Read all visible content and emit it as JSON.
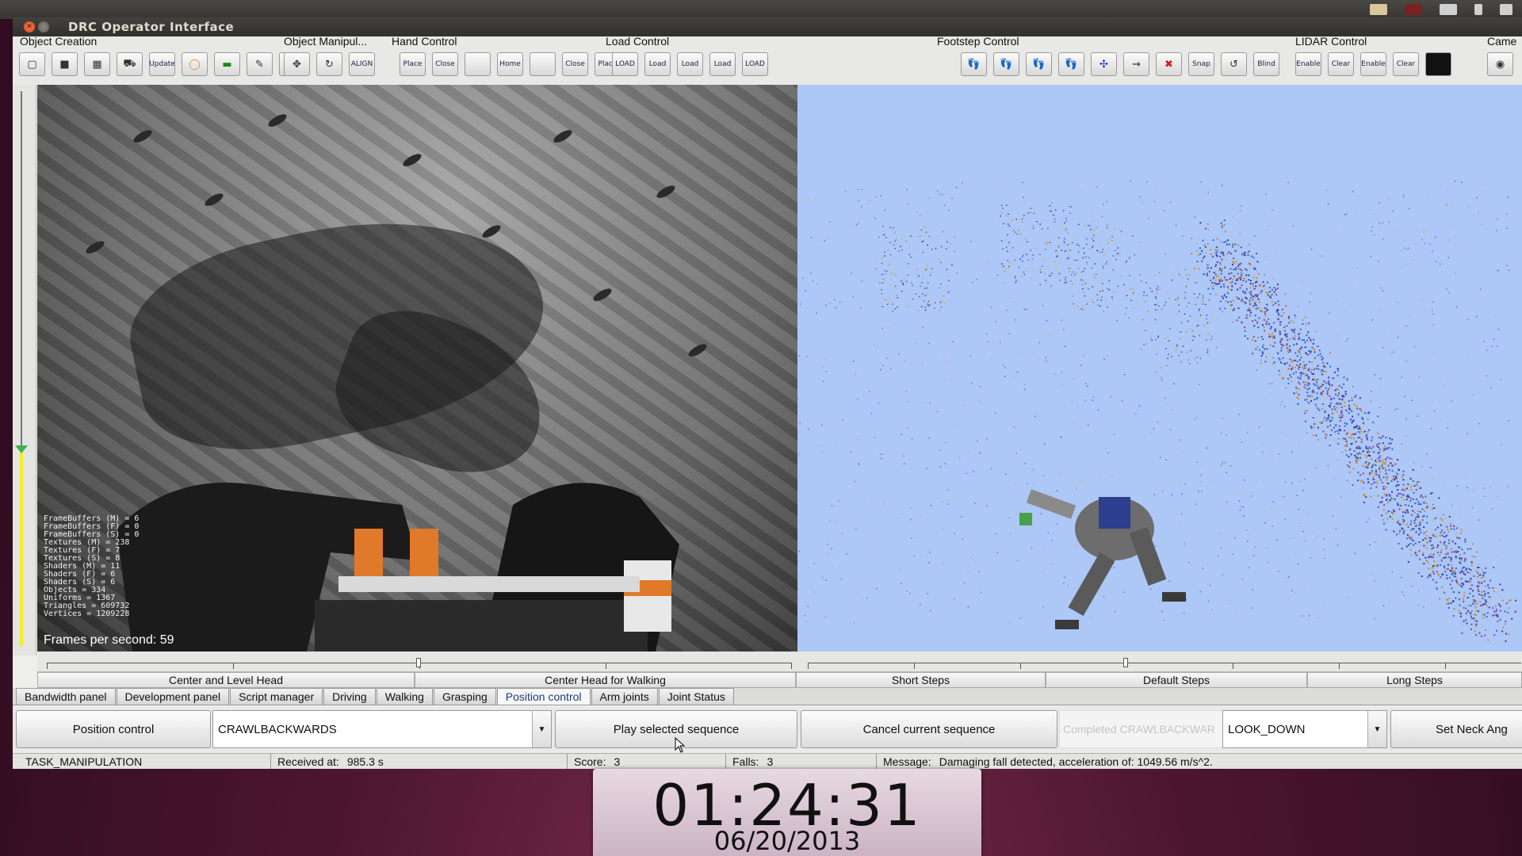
{
  "window": {
    "title": "DRC Operator Interface"
  },
  "toolbar": {
    "groups": [
      {
        "title": "Object Creation",
        "buttons": [
          "",
          "",
          "",
          "",
          "Update",
          "",
          "",
          "",
          ""
        ]
      },
      {
        "title": "Object Manipul...",
        "buttons": [
          "",
          "",
          "ALIGN"
        ]
      },
      {
        "title": "Hand Control",
        "buttons": [
          "Place",
          "Close",
          "",
          "Home",
          "",
          "Close",
          "Place"
        ]
      },
      {
        "title": "Load Control",
        "buttons": [
          "LOAD",
          "Load",
          "Load",
          "Load",
          "LOAD"
        ]
      },
      {
        "title": "Footstep Control",
        "buttons": [
          "",
          "",
          "",
          "",
          "",
          "",
          "",
          "Snap",
          "",
          "Blind"
        ]
      },
      {
        "title": "LIDAR Control",
        "buttons": [
          "Enable",
          "Clear",
          "Enable",
          "Clear",
          ""
        ]
      },
      {
        "title": "Came",
        "buttons": [
          ""
        ]
      }
    ]
  },
  "camera": {
    "stats": "FrameBuffers (M) = 6\nFrameBuffers (F) = 0\nFrameBuffers (S) = 0\nTextures (M) = 238\nTextures (F) = 7\nTextures (S) = 8\nShaders (M) = 11\nShaders (F) = 6\nShaders (S) = 6\nObjects = 334\nUniforms = 1367\nTriangles = 609732\nVertices = 1209228",
    "fps": "Frames per second: 59"
  },
  "presets": {
    "center_level": "Center and Level Head",
    "center_walk": "Center Head for Walking",
    "short": "Short Steps",
    "default": "Default Steps",
    "long": "Long Steps"
  },
  "tabs": [
    {
      "label": "Bandwidth panel",
      "active": false
    },
    {
      "label": "Development panel",
      "active": false
    },
    {
      "label": "Script manager",
      "active": false
    },
    {
      "label": "Driving",
      "active": false
    },
    {
      "label": "Walking",
      "active": false
    },
    {
      "label": "Grasping",
      "active": false
    },
    {
      "label": "Position control",
      "active": true
    },
    {
      "label": "Arm joints",
      "active": false
    },
    {
      "label": "Joint Status",
      "active": false
    }
  ],
  "controls": {
    "mode_button": "Position control",
    "sequence_select": "CRAWLBACKWARDS",
    "play_button": "Play selected sequence",
    "cancel_button": "Cancel current sequence",
    "completed_label": "Completed CRAWLBACKWAR",
    "neck_select": "LOOK_DOWN",
    "neck_button": "Set Neck Ang"
  },
  "status": {
    "task": "TASK_MANIPULATION",
    "received_label": "Received at:",
    "received_value": "985.3 s",
    "score_label": "Score:",
    "score_value": "3",
    "falls_label": "Falls:",
    "falls_value": "3",
    "message_label": "Message:",
    "message_value": "Damaging fall detected, acceleration of: 1049.56 m/s^2."
  },
  "clock": {
    "time": "01:24:31",
    "date": "06/20/2013"
  },
  "colors": {
    "lidar_bg": "#adc7f7",
    "slider_fill": "#f2ec2a",
    "close_btn": "#e0541f"
  }
}
